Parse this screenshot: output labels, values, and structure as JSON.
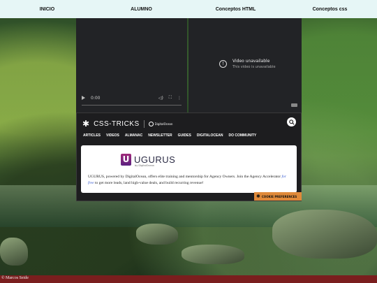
{
  "nav": {
    "items": [
      "INICIO",
      "ALUMNO",
      "Conceptos HTML",
      "Conceptos css"
    ]
  },
  "video1": {
    "time": "0:00"
  },
  "video2": {
    "title": "Video unavailable",
    "subtitle": "This video is unavailable"
  },
  "csstricks": {
    "logo": "CSS-TRICKS",
    "sponsor": "DigitalOcean",
    "nav": [
      "ARTICLES",
      "VIDEOS",
      "ALMANAC",
      "NEWSLETTER",
      "GUIDES",
      "DIGITALOCEAN",
      "DO COMMUNITY"
    ],
    "ad": {
      "brand": "UGURUS",
      "brand_by": "by DigitalOcean",
      "text_before": "UGURUS, powered by DigitalOcean, offers elite training and mentorship for Agency Owners. Join the Agency Accelerator ",
      "link": "for free",
      "text_after": " to get more leads, land high-value deals, and build recurring revenue!"
    },
    "cookie": "COOKIE PREFERENCES"
  },
  "footer": {
    "credit": "© Marcos Seide"
  },
  "colors": {
    "nav_bg": "#e6f6f6",
    "footer_bg": "#7a1e1e",
    "cookie_bg": "#e08a3a"
  }
}
